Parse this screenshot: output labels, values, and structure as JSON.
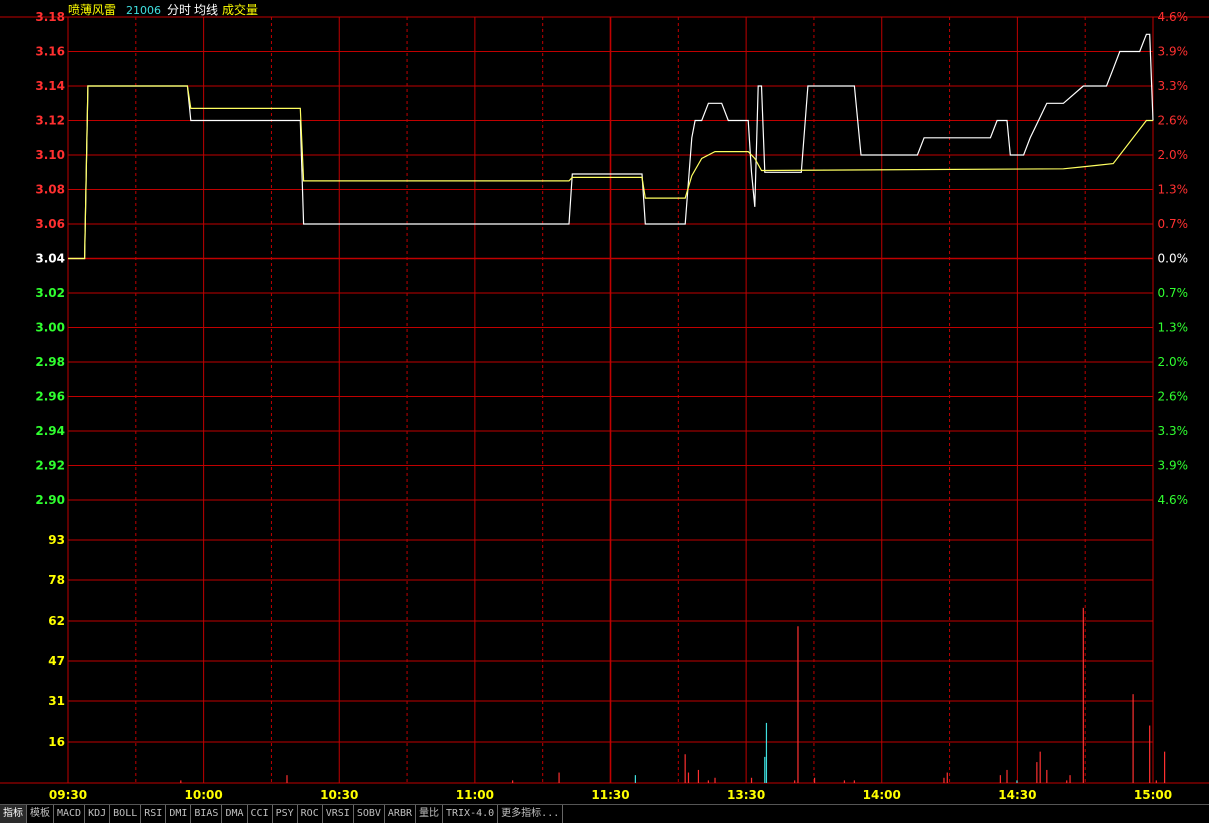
{
  "header": {
    "stock_name": "喷薄风雷",
    "stock_code": "21006",
    "mode": "分时",
    "avg_label": "均线",
    "vol_label": "成交量"
  },
  "colors": {
    "grid": "#c00000",
    "price_line": "#ffffff",
    "avg_line": "#ffff60",
    "up": "#ff3030",
    "down": "#30ff30",
    "flat": "#ffffff",
    "volume_label": "#ffff00",
    "time_label": "#ffff00",
    "volume_up": "#ff3030",
    "volume_down": "#40e0e0"
  },
  "chart_data": [
    {
      "type": "line",
      "title": "",
      "y_left_ticks": [
        "3.18",
        "3.16",
        "3.14",
        "3.12",
        "3.10",
        "3.08",
        "3.06",
        "3.04",
        "3.02",
        "3.00",
        "2.98",
        "2.96",
        "2.94",
        "2.92",
        "2.90"
      ],
      "y_right_ticks": [
        "4.6%",
        "3.9%",
        "3.3%",
        "2.6%",
        "2.0%",
        "1.3%",
        "0.7%",
        "0.0%",
        "0.7%",
        "1.3%",
        "2.0%",
        "2.6%",
        "3.3%",
        "3.9%",
        "4.6%"
      ],
      "base_price": 3.04,
      "ylim": [
        2.9,
        3.18
      ],
      "x_ticks": [
        "09:30",
        "10:00",
        "10:30",
        "11:00",
        "11:30",
        "13:30",
        "14:00",
        "14:30",
        "15:00"
      ],
      "series": [
        {
          "points": [
            [
              0,
              3.04
            ],
            [
              10,
              3.04
            ],
            [
              12,
              3.14
            ],
            [
              72,
              3.14
            ],
            [
              74,
              3.12
            ],
            [
              140,
              3.12
            ],
            [
              142,
              3.06
            ],
            [
              302,
              3.06
            ],
            [
              304,
              3.089
            ],
            [
              346,
              3.089
            ],
            [
              348,
              3.06
            ],
            [
              372,
              3.06
            ],
            [
              376,
              3.11
            ],
            [
              378,
              3.12
            ],
            [
              382,
              3.12
            ],
            [
              386,
              3.13
            ],
            [
              394,
              3.13
            ],
            [
              398,
              3.12
            ],
            [
              408,
              3.12
            ],
            [
              410,
              3.12
            ],
            [
              412,
              3.09
            ],
            [
              414,
              3.07
            ],
            [
              416,
              3.14
            ],
            [
              418,
              3.14
            ],
            [
              420,
              3.09
            ],
            [
              442,
              3.09
            ],
            [
              446,
              3.14
            ],
            [
              474,
              3.14
            ],
            [
              478,
              3.1
            ],
            [
              512,
              3.1
            ],
            [
              516,
              3.11
            ],
            [
              556,
              3.11
            ],
            [
              560,
              3.12
            ],
            [
              566,
              3.12
            ],
            [
              568,
              3.1
            ],
            [
              576,
              3.1
            ],
            [
              580,
              3.11
            ],
            [
              590,
              3.13
            ],
            [
              600,
              3.13
            ],
            [
              612,
              3.14
            ],
            [
              626,
              3.14
            ],
            [
              630,
              3.15
            ],
            [
              634,
              3.16
            ],
            [
              646,
              3.16
            ],
            [
              650,
              3.17
            ],
            [
              652,
              3.17
            ],
            [
              654,
              3.12
            ]
          ]
        },
        {
          "points": [
            [
              0,
              3.04
            ],
            [
              10,
              3.04
            ],
            [
              12,
              3.14
            ],
            [
              72,
              3.14
            ],
            [
              74,
              3.127
            ],
            [
              140,
              3.127
            ],
            [
              142,
              3.085
            ],
            [
              302,
              3.085
            ],
            [
              304,
              3.087
            ],
            [
              346,
              3.087
            ],
            [
              348,
              3.075
            ],
            [
              372,
              3.075
            ],
            [
              376,
              3.088
            ],
            [
              382,
              3.098
            ],
            [
              390,
              3.102
            ],
            [
              410,
              3.102
            ],
            [
              414,
              3.098
            ],
            [
              418,
              3.091
            ],
            [
              600,
              3.092
            ],
            [
              610,
              3.093
            ],
            [
              620,
              3.094
            ],
            [
              630,
              3.095
            ],
            [
              650,
              3.12
            ],
            [
              654,
              3.12
            ]
          ]
        }
      ]
    },
    {
      "type": "bar",
      "title": "",
      "y_ticks": [
        "93",
        "78",
        "62",
        "47",
        "31",
        "16"
      ],
      "ylim": [
        0,
        93
      ],
      "x": [
        68,
        132,
        268,
        296,
        342,
        372,
        374,
        380,
        386,
        390,
        412,
        420,
        421,
        438,
        440,
        450,
        468,
        474,
        528,
        530,
        562,
        566,
        572,
        584,
        586,
        590,
        602,
        604,
        612,
        642,
        652,
        656,
        661
      ],
      "values": [
        1,
        3,
        1,
        4,
        3,
        11,
        4,
        5,
        1,
        2,
        2,
        10,
        23,
        1,
        60,
        2,
        1,
        1,
        2,
        4,
        3,
        5,
        1,
        8,
        12,
        5,
        1,
        3,
        67,
        34,
        22,
        1,
        12
      ],
      "colors": [
        "up",
        "up",
        "up",
        "up",
        "down",
        "up",
        "up",
        "up",
        "up",
        "up",
        "up",
        "down",
        "down",
        "up",
        "up",
        "up",
        "up",
        "up",
        "up",
        "up",
        "up",
        "up",
        "down",
        "up",
        "up",
        "up",
        "up",
        "up",
        "up",
        "up",
        "up",
        "up",
        "up"
      ]
    }
  ],
  "tabs": [
    "指标",
    "模板",
    "MACD",
    "KDJ",
    "BOLL",
    "RSI",
    "DMI",
    "BIAS",
    "DMA",
    "CCI",
    "PSY",
    "ROC",
    "VRSI",
    "SOBV",
    "ARBR",
    "量比",
    "TRIX-4.0",
    "更多指标..."
  ]
}
